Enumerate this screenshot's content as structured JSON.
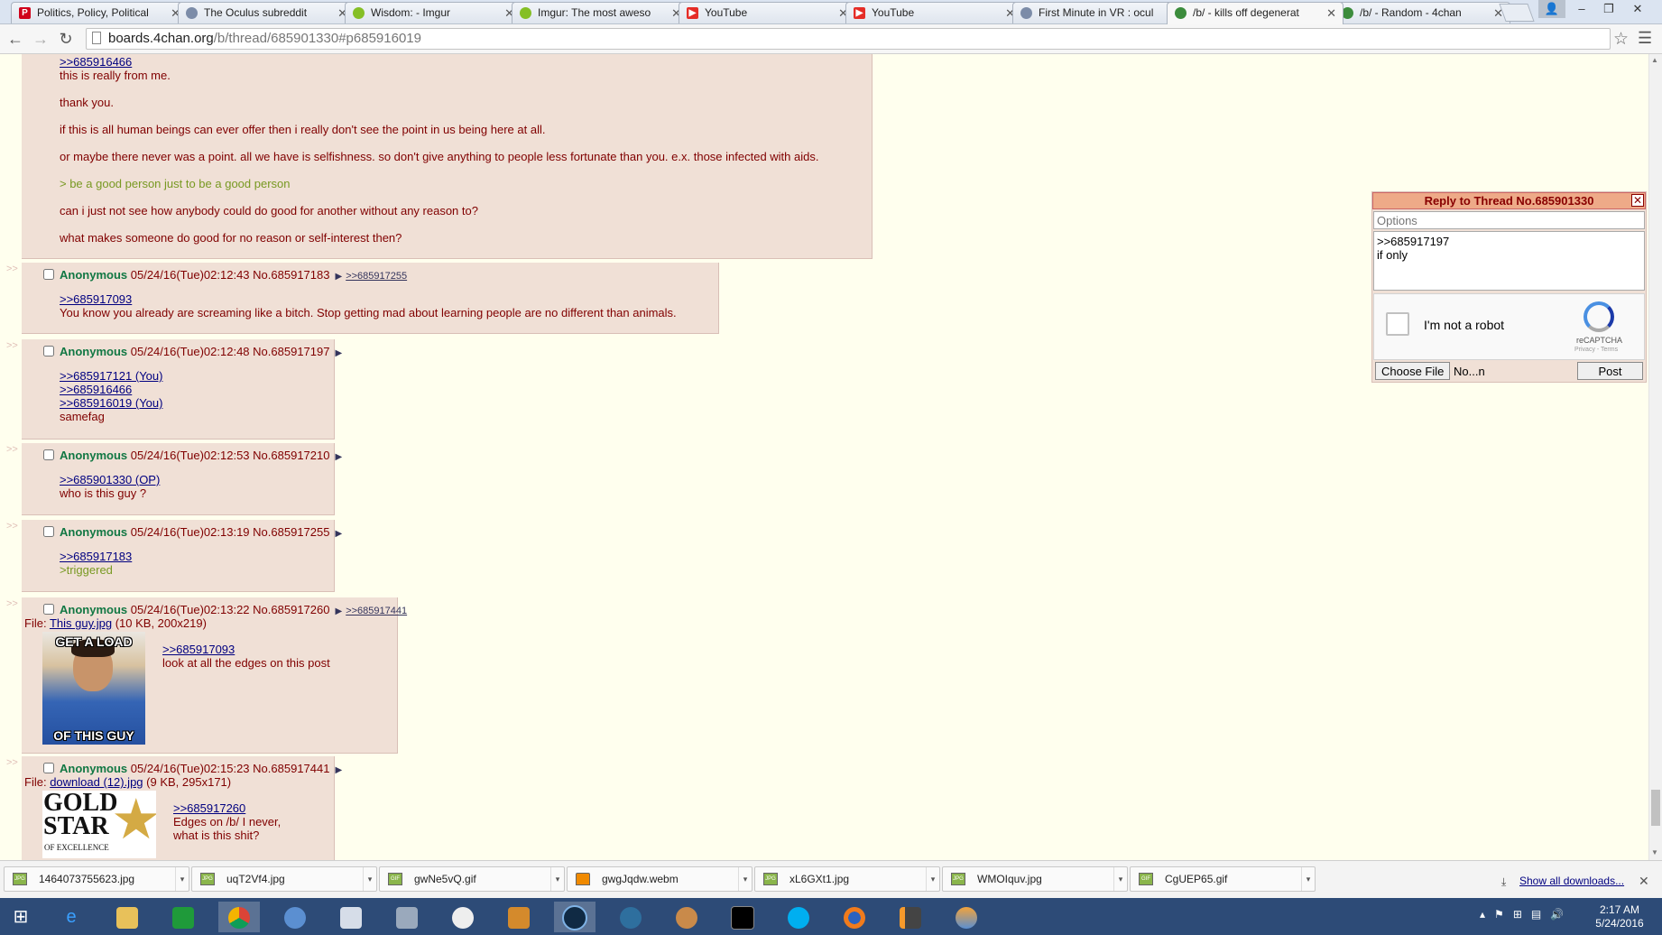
{
  "browser": {
    "tabs": [
      {
        "title": "Politics, Policy, Political",
        "favicon": "politico-icon",
        "color": "#d0021b",
        "letter": "P"
      },
      {
        "title": "The Oculus subreddit",
        "favicon": "reddit-icon",
        "color": "#7c8ca8",
        "letter": ""
      },
      {
        "title": "Wisdom: - Imgur",
        "favicon": "imgur-icon",
        "color": "#85bf25",
        "letter": ""
      },
      {
        "title": "Imgur: The most aweso",
        "favicon": "imgur-icon",
        "color": "#85bf25",
        "letter": ""
      },
      {
        "title": "YouTube",
        "favicon": "youtube-icon",
        "color": "#e52d27",
        "letter": ""
      },
      {
        "title": "YouTube",
        "favicon": "youtube-icon",
        "color": "#e52d27",
        "letter": ""
      },
      {
        "title": "First Minute in VR : ocul",
        "favicon": "reddit-icon",
        "color": "#7c8ca8",
        "letter": ""
      },
      {
        "title": "/b/ - kills off degenerat",
        "favicon": "4chan-clover-icon",
        "color": "#3c8c3c",
        "letter": "",
        "active": true
      },
      {
        "title": "/b/ - Random - 4chan",
        "favicon": "4chan-clover-icon",
        "color": "#3c8c3c",
        "letter": ""
      }
    ],
    "address": {
      "host": "boards.4chan.org",
      "path": "/b/thread/685901330#p685916019"
    },
    "window_controls": {
      "minimize": "–",
      "restore": "❐",
      "close": "✕"
    }
  },
  "thread": {
    "op_tail": {
      "lines": [
        {
          "type": "quote",
          "text": ">>685916466"
        },
        {
          "type": "text",
          "text": "this is really from me."
        },
        {
          "type": "text",
          "text": "thank you."
        },
        {
          "type": "text",
          "text": "if this is all human beings can ever offer then i really don't see the point in us being here at all."
        },
        {
          "type": "text",
          "text": "or maybe there never was a point. all we have is selfishness. so don't give anything to people less fortunate than you. e.x. those infected with aids."
        },
        {
          "type": "green",
          "text": "> be a good person just to be a good person"
        },
        {
          "type": "text",
          "text": "can i just not see how anybody could do good for another without any reason to?"
        },
        {
          "type": "text",
          "text": "what makes someone do good for no reason or self-interest then?"
        }
      ]
    },
    "posts": [
      {
        "name": "Anonymous",
        "date": "05/24/16(Tue)02:12:43",
        "no": "No.685917183",
        "backlink": ">>685917255",
        "quotes": [
          ">>685917093"
        ],
        "body": [
          "You know you already are screaming like a bitch. Stop getting mad about learning people are no different than animals."
        ],
        "green": []
      },
      {
        "name": "Anonymous",
        "date": "05/24/16(Tue)02:12:48",
        "no": "No.685917197",
        "backlink": "",
        "quotes": [
          ">>685917121 (You)",
          ">>685916466",
          ">>685916019 (You)"
        ],
        "body": [
          "samefag"
        ],
        "green": []
      },
      {
        "name": "Anonymous",
        "date": "05/24/16(Tue)02:12:53",
        "no": "No.685917210",
        "backlink": "",
        "quotes": [
          ">>685901330 (OP)"
        ],
        "body": [
          "who is this guy ?"
        ],
        "green": []
      },
      {
        "name": "Anonymous",
        "date": "05/24/16(Tue)02:13:19",
        "no": "No.685917255",
        "backlink": "",
        "quotes": [
          ">>685917183"
        ],
        "body": [],
        "green": [
          ">triggered"
        ]
      },
      {
        "name": "Anonymous",
        "date": "05/24/16(Tue)02:13:22",
        "no": "No.685917260",
        "backlink": ">>685917441",
        "file_label": "File:",
        "file_name": "This guy.jpg",
        "file_meta": "(10 KB, 200x219)",
        "img_top": "GET A LOAD",
        "img_bottom": "OF THIS GUY",
        "quotes": [
          ">>685917093"
        ],
        "body": [
          "look at all the edges on this post"
        ],
        "green": []
      },
      {
        "name": "Anonymous",
        "date": "05/24/16(Tue)02:15:23",
        "no": "No.685917441",
        "backlink": "",
        "file_label": "File:",
        "file_name": "download (12).jpg",
        "file_meta": "(9 KB, 295x171)",
        "img_line1": "GOLD",
        "img_line2": "STAR",
        "img_line3": "OF EXCELLENCE",
        "quotes": [
          ">>685917260"
        ],
        "body": [
          "Edges on /b/ I never,",
          "what is this shit?"
        ],
        "green": []
      }
    ],
    "side_marker": ">>"
  },
  "quick_reply": {
    "title": "Reply to Thread No.685901330",
    "options_placeholder": "Options",
    "comment": ">>685917197\nif only",
    "captcha_label": "I'm not a robot",
    "captcha_brand": "reCAPTCHA",
    "captcha_terms": "Privacy - Terms",
    "choose_file": "Choose File",
    "file_name": "No...n",
    "post_button": "Post"
  },
  "downloads": {
    "items": [
      "1464073755623.jpg",
      "uqT2Vf4.jpg",
      "gwNe5vQ.gif",
      "gwgJqdw.webm",
      "xL6GXt1.jpg",
      "WMOIquv.jpg",
      "CgUEP65.gif"
    ],
    "show_all": "Show all downloads..."
  },
  "taskbar": {
    "time": "2:17 AM",
    "date": "5/24/2016"
  }
}
